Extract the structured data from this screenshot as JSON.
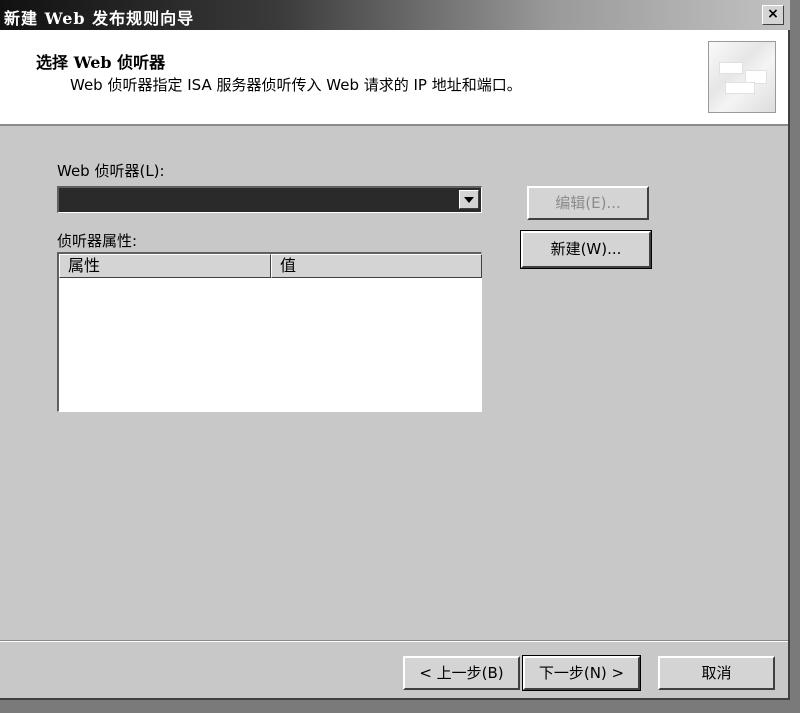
{
  "window": {
    "title": "新建 Web 发布规则向导",
    "close_glyph": "×"
  },
  "header": {
    "title": "选择 Web 侦听器",
    "subtitle": "Web 侦听器指定 ISA 服务器侦听传入 Web 请求的 IP 地址和端口。",
    "icon": "wizard-banner-icon"
  },
  "form": {
    "listener_label": "Web 侦听器(L):",
    "listener_value": "",
    "properties_label": "侦听器属性:",
    "edit_button": "编辑(E)...",
    "new_button": "新建(W)...",
    "table": {
      "columns": [
        "属性",
        "值"
      ],
      "rows": []
    }
  },
  "footer": {
    "back_button": "< 上一步(B)",
    "next_button": "下一步(N) >",
    "cancel_button": "取消"
  }
}
